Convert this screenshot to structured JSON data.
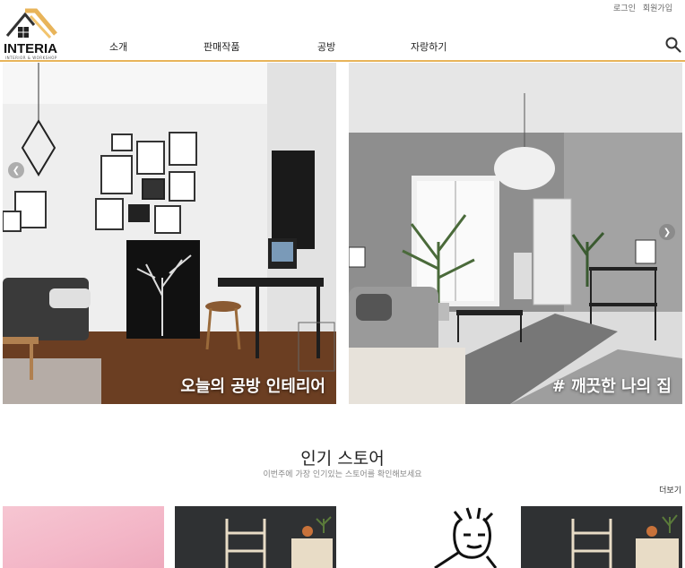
{
  "header": {
    "logo_text": "INTERIA",
    "logo_subtext": "INTERIOR & WORKSHOP",
    "login": "로그인",
    "signup": "회원가입",
    "nav": [
      {
        "label": "소개"
      },
      {
        "label": "판매작품"
      },
      {
        "label": "공방"
      },
      {
        "label": "자랑하기"
      }
    ],
    "search_icon": "search-icon",
    "accent_color": "#e8b45a"
  },
  "hero": {
    "slides": [
      {
        "caption": "오늘의 공방 인테리어"
      },
      {
        "caption": "# 깨끗한 나의 집"
      }
    ],
    "prev_icon": "chevron-left-icon",
    "next_icon": "chevron-right-icon"
  },
  "stores": {
    "title": "인기 스토어",
    "subtitle": "이번주에 가장 인기있는 스토어를 확인해보세요",
    "more": "더보기"
  }
}
